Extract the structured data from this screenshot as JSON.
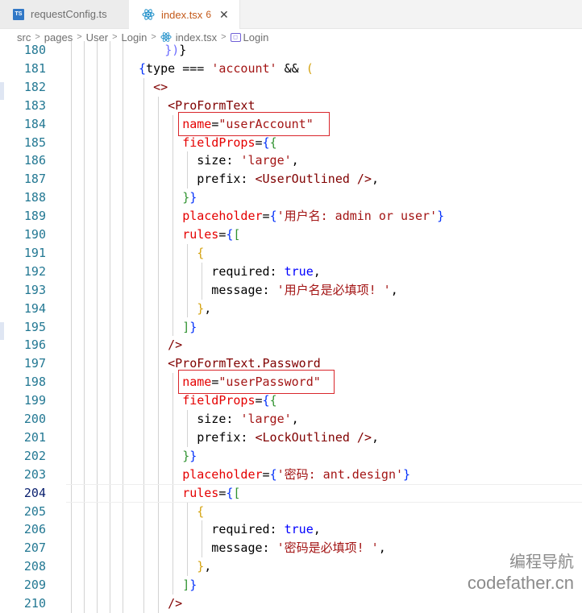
{
  "tabs": [
    {
      "icon": "ts-icon",
      "badge": "TS",
      "label": "requestConfig.ts"
    },
    {
      "icon": "react-icon",
      "label": "index.tsx",
      "problems": "6",
      "close": "✕"
    }
  ],
  "breadcrumb": {
    "items": [
      "src",
      "pages",
      "User",
      "Login",
      "index.tsx",
      "Login"
    ],
    "separator": ">"
  },
  "editor": {
    "active_line": "204",
    "lines": [
      {
        "n": "180",
        "tokens": [
          [
            "p",
            "      "
          ],
          [
            "m",
            "})"
          ],
          [
            "p",
            "}"
          ]
        ]
      },
      {
        "n": "181",
        "tokens": [
          [
            "b1",
            "{"
          ],
          [
            "p",
            "type "
          ],
          [
            "p",
            "=== "
          ],
          [
            "s",
            "'account'"
          ],
          [
            "p",
            " && "
          ],
          [
            "y",
            "("
          ]
        ]
      },
      {
        "n": "182",
        "tokens": [
          [
            "p",
            "  "
          ],
          [
            "t",
            "<>"
          ]
        ]
      },
      {
        "n": "183",
        "tokens": [
          [
            "p",
            "    "
          ],
          [
            "t",
            "<ProFormText"
          ]
        ]
      },
      {
        "n": "184",
        "tokens": [
          [
            "p",
            "      "
          ],
          [
            "a",
            "name"
          ],
          [
            "p",
            "="
          ],
          [
            "s",
            "\"userAccount\""
          ]
        ]
      },
      {
        "n": "185",
        "tokens": [
          [
            "p",
            "      "
          ],
          [
            "a",
            "fieldProps"
          ],
          [
            "p",
            "="
          ],
          [
            "b1",
            "{"
          ],
          [
            "b2",
            "{"
          ]
        ]
      },
      {
        "n": "186",
        "tokens": [
          [
            "p",
            "        size: "
          ],
          [
            "s",
            "'large'"
          ],
          [
            "p",
            ","
          ]
        ]
      },
      {
        "n": "187",
        "tokens": [
          [
            "p",
            "        prefix: "
          ],
          [
            "t",
            "<UserOutlined />"
          ],
          [
            "p",
            ","
          ]
        ]
      },
      {
        "n": "188",
        "tokens": [
          [
            "p",
            "      "
          ],
          [
            "b2",
            "}"
          ],
          [
            "b1",
            "}"
          ]
        ]
      },
      {
        "n": "189",
        "tokens": [
          [
            "p",
            "      "
          ],
          [
            "a",
            "placeholder"
          ],
          [
            "p",
            "="
          ],
          [
            "b1",
            "{"
          ],
          [
            "s",
            "'用户名: admin or user'"
          ],
          [
            "b1",
            "}"
          ]
        ]
      },
      {
        "n": "190",
        "tokens": [
          [
            "p",
            "      "
          ],
          [
            "a",
            "rules"
          ],
          [
            "p",
            "="
          ],
          [
            "b1",
            "{"
          ],
          [
            "b2",
            "["
          ]
        ]
      },
      {
        "n": "191",
        "tokens": [
          [
            "p",
            "        "
          ],
          [
            "y",
            "{"
          ]
        ]
      },
      {
        "n": "192",
        "tokens": [
          [
            "p",
            "          required: "
          ],
          [
            "bl",
            "true"
          ],
          [
            "p",
            ","
          ]
        ]
      },
      {
        "n": "193",
        "tokens": [
          [
            "p",
            "          message: "
          ],
          [
            "s",
            "'用户名是必填项! '"
          ],
          [
            "p",
            ","
          ]
        ]
      },
      {
        "n": "194",
        "tokens": [
          [
            "p",
            "        "
          ],
          [
            "y",
            "}"
          ],
          [
            "p",
            ","
          ]
        ]
      },
      {
        "n": "195",
        "tokens": [
          [
            "p",
            "      "
          ],
          [
            "b2",
            "]"
          ],
          [
            "b1",
            "}"
          ]
        ]
      },
      {
        "n": "196",
        "tokens": [
          [
            "p",
            "    "
          ],
          [
            "t",
            "/>"
          ]
        ]
      },
      {
        "n": "197",
        "tokens": [
          [
            "p",
            "    "
          ],
          [
            "t",
            "<ProFormText.Password"
          ]
        ]
      },
      {
        "n": "198",
        "tokens": [
          [
            "p",
            "      "
          ],
          [
            "a",
            "name"
          ],
          [
            "p",
            "="
          ],
          [
            "s",
            "\"userPassword\""
          ]
        ]
      },
      {
        "n": "199",
        "tokens": [
          [
            "p",
            "      "
          ],
          [
            "a",
            "fieldProps"
          ],
          [
            "p",
            "="
          ],
          [
            "b1",
            "{"
          ],
          [
            "b2",
            "{"
          ]
        ]
      },
      {
        "n": "200",
        "tokens": [
          [
            "p",
            "        size: "
          ],
          [
            "s",
            "'large'"
          ],
          [
            "p",
            ","
          ]
        ]
      },
      {
        "n": "201",
        "tokens": [
          [
            "p",
            "        prefix: "
          ],
          [
            "t",
            "<LockOutlined />"
          ],
          [
            "p",
            ","
          ]
        ]
      },
      {
        "n": "202",
        "tokens": [
          [
            "p",
            "      "
          ],
          [
            "b2",
            "}"
          ],
          [
            "b1",
            "}"
          ]
        ]
      },
      {
        "n": "203",
        "tokens": [
          [
            "p",
            "      "
          ],
          [
            "a",
            "placeholder"
          ],
          [
            "p",
            "="
          ],
          [
            "b1",
            "{"
          ],
          [
            "s",
            "'密码: ant.design'"
          ],
          [
            "b1",
            "}"
          ]
        ]
      },
      {
        "n": "204",
        "tokens": [
          [
            "p",
            "      "
          ],
          [
            "a",
            "rules"
          ],
          [
            "p",
            "="
          ],
          [
            "b1",
            "{"
          ],
          [
            "b2",
            "["
          ]
        ]
      },
      {
        "n": "205",
        "tokens": [
          [
            "p",
            "        "
          ],
          [
            "y",
            "{"
          ]
        ]
      },
      {
        "n": "206",
        "tokens": [
          [
            "p",
            "          required: "
          ],
          [
            "bl",
            "true"
          ],
          [
            "p",
            ","
          ]
        ]
      },
      {
        "n": "207",
        "tokens": [
          [
            "p",
            "          message: "
          ],
          [
            "s",
            "'密码是必填项! '"
          ],
          [
            "p",
            ","
          ]
        ]
      },
      {
        "n": "208",
        "tokens": [
          [
            "p",
            "        "
          ],
          [
            "y",
            "}"
          ],
          [
            "p",
            ","
          ]
        ]
      },
      {
        "n": "209",
        "tokens": [
          [
            "p",
            "      "
          ],
          [
            "b2",
            "]"
          ],
          [
            "b1",
            "}"
          ]
        ]
      },
      {
        "n": "210",
        "tokens": [
          [
            "p",
            "    "
          ],
          [
            "t",
            "/>"
          ]
        ]
      }
    ]
  },
  "watermark": {
    "line1": "编程导航",
    "line2": "codefather.cn"
  }
}
